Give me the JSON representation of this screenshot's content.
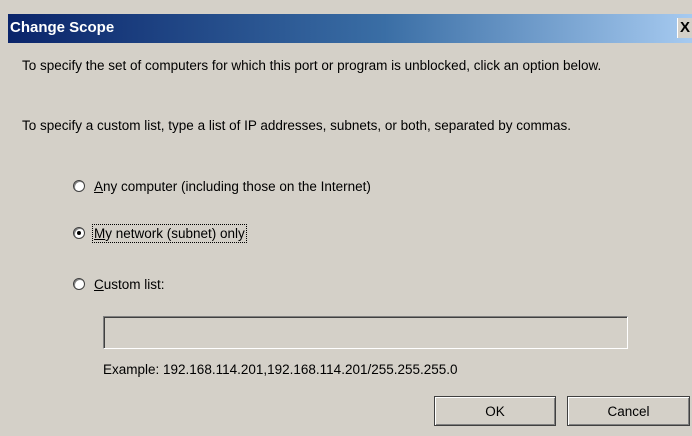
{
  "dialog": {
    "title": "Change Scope",
    "close_label": "X"
  },
  "instructions": {
    "intro": "To specify the set of computers for which this port or program is unblocked, click an option below.",
    "custom": "To specify a custom list, type a list of IP addresses, subnets, or both, separated by commas."
  },
  "options": [
    {
      "mnemonic": "A",
      "rest": "ny computer (including those on the Internet)",
      "checked": false
    },
    {
      "mnemonic": "M",
      "rest": "y network (subnet) only",
      "checked": true
    },
    {
      "mnemonic": "C",
      "rest": "ustom list:",
      "checked": false
    }
  ],
  "custom_list": {
    "value": "",
    "example": "Example: 192.168.114.201,192.168.114.201/255.255.255.0"
  },
  "buttons": {
    "ok": "OK",
    "cancel": "Cancel"
  }
}
